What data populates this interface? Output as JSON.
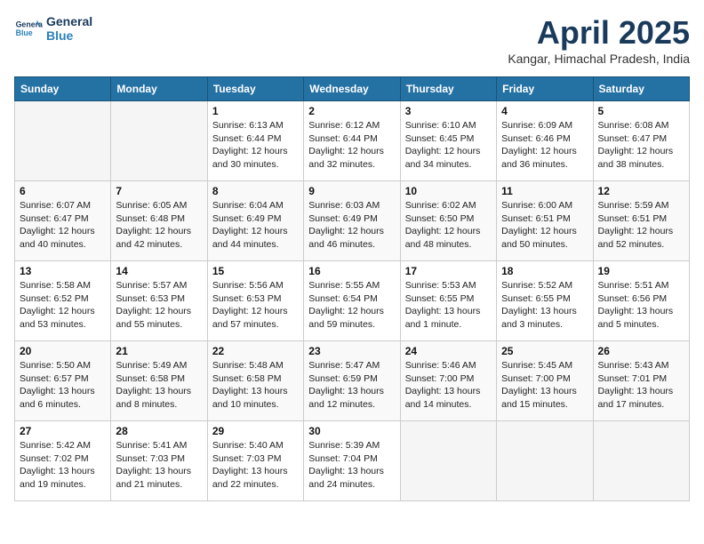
{
  "header": {
    "logo_line1": "General",
    "logo_line2": "Blue",
    "month": "April 2025",
    "location": "Kangar, Himachal Pradesh, India"
  },
  "weekdays": [
    "Sunday",
    "Monday",
    "Tuesday",
    "Wednesday",
    "Thursday",
    "Friday",
    "Saturday"
  ],
  "weeks": [
    [
      {
        "day": "",
        "info": ""
      },
      {
        "day": "",
        "info": ""
      },
      {
        "day": "1",
        "info": "Sunrise: 6:13 AM\nSunset: 6:44 PM\nDaylight: 12 hours\nand 30 minutes."
      },
      {
        "day": "2",
        "info": "Sunrise: 6:12 AM\nSunset: 6:44 PM\nDaylight: 12 hours\nand 32 minutes."
      },
      {
        "day": "3",
        "info": "Sunrise: 6:10 AM\nSunset: 6:45 PM\nDaylight: 12 hours\nand 34 minutes."
      },
      {
        "day": "4",
        "info": "Sunrise: 6:09 AM\nSunset: 6:46 PM\nDaylight: 12 hours\nand 36 minutes."
      },
      {
        "day": "5",
        "info": "Sunrise: 6:08 AM\nSunset: 6:47 PM\nDaylight: 12 hours\nand 38 minutes."
      }
    ],
    [
      {
        "day": "6",
        "info": "Sunrise: 6:07 AM\nSunset: 6:47 PM\nDaylight: 12 hours\nand 40 minutes."
      },
      {
        "day": "7",
        "info": "Sunrise: 6:05 AM\nSunset: 6:48 PM\nDaylight: 12 hours\nand 42 minutes."
      },
      {
        "day": "8",
        "info": "Sunrise: 6:04 AM\nSunset: 6:49 PM\nDaylight: 12 hours\nand 44 minutes."
      },
      {
        "day": "9",
        "info": "Sunrise: 6:03 AM\nSunset: 6:49 PM\nDaylight: 12 hours\nand 46 minutes."
      },
      {
        "day": "10",
        "info": "Sunrise: 6:02 AM\nSunset: 6:50 PM\nDaylight: 12 hours\nand 48 minutes."
      },
      {
        "day": "11",
        "info": "Sunrise: 6:00 AM\nSunset: 6:51 PM\nDaylight: 12 hours\nand 50 minutes."
      },
      {
        "day": "12",
        "info": "Sunrise: 5:59 AM\nSunset: 6:51 PM\nDaylight: 12 hours\nand 52 minutes."
      }
    ],
    [
      {
        "day": "13",
        "info": "Sunrise: 5:58 AM\nSunset: 6:52 PM\nDaylight: 12 hours\nand 53 minutes."
      },
      {
        "day": "14",
        "info": "Sunrise: 5:57 AM\nSunset: 6:53 PM\nDaylight: 12 hours\nand 55 minutes."
      },
      {
        "day": "15",
        "info": "Sunrise: 5:56 AM\nSunset: 6:53 PM\nDaylight: 12 hours\nand 57 minutes."
      },
      {
        "day": "16",
        "info": "Sunrise: 5:55 AM\nSunset: 6:54 PM\nDaylight: 12 hours\nand 59 minutes."
      },
      {
        "day": "17",
        "info": "Sunrise: 5:53 AM\nSunset: 6:55 PM\nDaylight: 13 hours\nand 1 minute."
      },
      {
        "day": "18",
        "info": "Sunrise: 5:52 AM\nSunset: 6:55 PM\nDaylight: 13 hours\nand 3 minutes."
      },
      {
        "day": "19",
        "info": "Sunrise: 5:51 AM\nSunset: 6:56 PM\nDaylight: 13 hours\nand 5 minutes."
      }
    ],
    [
      {
        "day": "20",
        "info": "Sunrise: 5:50 AM\nSunset: 6:57 PM\nDaylight: 13 hours\nand 6 minutes."
      },
      {
        "day": "21",
        "info": "Sunrise: 5:49 AM\nSunset: 6:58 PM\nDaylight: 13 hours\nand 8 minutes."
      },
      {
        "day": "22",
        "info": "Sunrise: 5:48 AM\nSunset: 6:58 PM\nDaylight: 13 hours\nand 10 minutes."
      },
      {
        "day": "23",
        "info": "Sunrise: 5:47 AM\nSunset: 6:59 PM\nDaylight: 13 hours\nand 12 minutes."
      },
      {
        "day": "24",
        "info": "Sunrise: 5:46 AM\nSunset: 7:00 PM\nDaylight: 13 hours\nand 14 minutes."
      },
      {
        "day": "25",
        "info": "Sunrise: 5:45 AM\nSunset: 7:00 PM\nDaylight: 13 hours\nand 15 minutes."
      },
      {
        "day": "26",
        "info": "Sunrise: 5:43 AM\nSunset: 7:01 PM\nDaylight: 13 hours\nand 17 minutes."
      }
    ],
    [
      {
        "day": "27",
        "info": "Sunrise: 5:42 AM\nSunset: 7:02 PM\nDaylight: 13 hours\nand 19 minutes."
      },
      {
        "day": "28",
        "info": "Sunrise: 5:41 AM\nSunset: 7:03 PM\nDaylight: 13 hours\nand 21 minutes."
      },
      {
        "day": "29",
        "info": "Sunrise: 5:40 AM\nSunset: 7:03 PM\nDaylight: 13 hours\nand 22 minutes."
      },
      {
        "day": "30",
        "info": "Sunrise: 5:39 AM\nSunset: 7:04 PM\nDaylight: 13 hours\nand 24 minutes."
      },
      {
        "day": "",
        "info": ""
      },
      {
        "day": "",
        "info": ""
      },
      {
        "day": "",
        "info": ""
      }
    ]
  ]
}
